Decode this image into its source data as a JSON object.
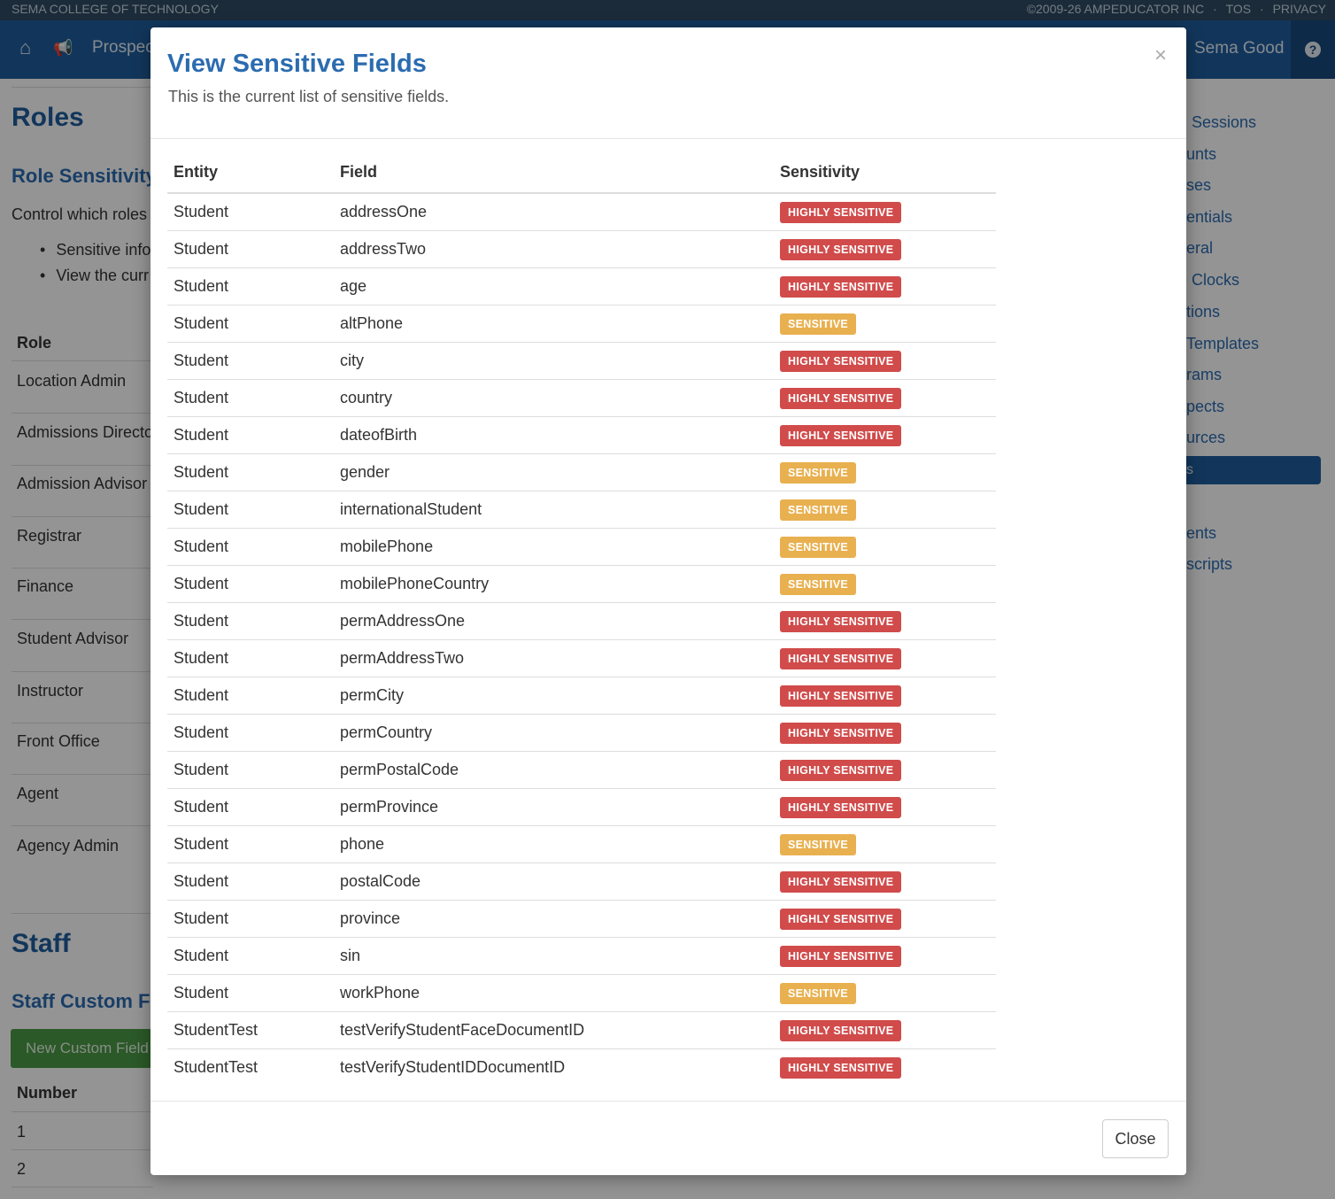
{
  "topstrip": {
    "school": "SEMA COLLEGE OF TECHNOLOGY",
    "copyright": "©2009-26 AMPEDUCATOR INC",
    "sep": "·",
    "tos": "TOS",
    "privacy": "PRIVACY"
  },
  "nav": {
    "home_glyph": "⌂",
    "announce_glyph": "📢",
    "prospects": "Prospec",
    "user": "Sema Good",
    "help_glyph": "?"
  },
  "background": {
    "roles_title": "Roles",
    "role_sensitivity": "Role Sensitivity",
    "control_text": "Control which roles",
    "bullets": [
      "Sensitive info",
      "View the curr"
    ],
    "role_header": "Role",
    "roles": [
      "Location Admin",
      "Admissions Directo",
      "Admission Advisor",
      "Registrar",
      "Finance",
      "Student Advisor",
      "Instructor",
      "Front Office",
      "Agent",
      "Agency Admin"
    ],
    "staff_title": "Staff",
    "staff_custom": "Staff Custom Fie",
    "new_custom_field": "New Custom Field",
    "number_header": "Number",
    "numbers": [
      "1",
      "2"
    ],
    "sidebar": [
      "Sessions",
      "unts",
      "ses",
      "entials",
      "eral",
      "Clocks",
      "tions",
      "Templates",
      "rams",
      "pects",
      "urces",
      "ents",
      "scripts"
    ],
    "sidebar_active": "s"
  },
  "modal": {
    "title": "View Sensitive Fields",
    "subtitle": "This is the current list of sensitive fields.",
    "close_x": "×",
    "close_button": "Close",
    "headers": {
      "entity": "Entity",
      "field": "Field",
      "sensitivity": "Sensitivity"
    },
    "rows": [
      {
        "entity": "Student",
        "field": "addressOne",
        "sensitivity": "HIGHLY SENSITIVE",
        "level": "high"
      },
      {
        "entity": "Student",
        "field": "addressTwo",
        "sensitivity": "HIGHLY SENSITIVE",
        "level": "high"
      },
      {
        "entity": "Student",
        "field": "age",
        "sensitivity": "HIGHLY SENSITIVE",
        "level": "high"
      },
      {
        "entity": "Student",
        "field": "altPhone",
        "sensitivity": "SENSITIVE",
        "level": "med"
      },
      {
        "entity": "Student",
        "field": "city",
        "sensitivity": "HIGHLY SENSITIVE",
        "level": "high"
      },
      {
        "entity": "Student",
        "field": "country",
        "sensitivity": "HIGHLY SENSITIVE",
        "level": "high"
      },
      {
        "entity": "Student",
        "field": "dateofBirth",
        "sensitivity": "HIGHLY SENSITIVE",
        "level": "high"
      },
      {
        "entity": "Student",
        "field": "gender",
        "sensitivity": "SENSITIVE",
        "level": "med"
      },
      {
        "entity": "Student",
        "field": "internationalStudent",
        "sensitivity": "SENSITIVE",
        "level": "med"
      },
      {
        "entity": "Student",
        "field": "mobilePhone",
        "sensitivity": "SENSITIVE",
        "level": "med"
      },
      {
        "entity": "Student",
        "field": "mobilePhoneCountry",
        "sensitivity": "SENSITIVE",
        "level": "med"
      },
      {
        "entity": "Student",
        "field": "permAddressOne",
        "sensitivity": "HIGHLY SENSITIVE",
        "level": "high"
      },
      {
        "entity": "Student",
        "field": "permAddressTwo",
        "sensitivity": "HIGHLY SENSITIVE",
        "level": "high"
      },
      {
        "entity": "Student",
        "field": "permCity",
        "sensitivity": "HIGHLY SENSITIVE",
        "level": "high"
      },
      {
        "entity": "Student",
        "field": "permCountry",
        "sensitivity": "HIGHLY SENSITIVE",
        "level": "high"
      },
      {
        "entity": "Student",
        "field": "permPostalCode",
        "sensitivity": "HIGHLY SENSITIVE",
        "level": "high"
      },
      {
        "entity": "Student",
        "field": "permProvince",
        "sensitivity": "HIGHLY SENSITIVE",
        "level": "high"
      },
      {
        "entity": "Student",
        "field": "phone",
        "sensitivity": "SENSITIVE",
        "level": "med"
      },
      {
        "entity": "Student",
        "field": "postalCode",
        "sensitivity": "HIGHLY SENSITIVE",
        "level": "high"
      },
      {
        "entity": "Student",
        "field": "province",
        "sensitivity": "HIGHLY SENSITIVE",
        "level": "high"
      },
      {
        "entity": "Student",
        "field": "sin",
        "sensitivity": "HIGHLY SENSITIVE",
        "level": "high"
      },
      {
        "entity": "Student",
        "field": "workPhone",
        "sensitivity": "SENSITIVE",
        "level": "med"
      },
      {
        "entity": "StudentTest",
        "field": "testVerifyStudentFaceDocumentID",
        "sensitivity": "HIGHLY SENSITIVE",
        "level": "high"
      },
      {
        "entity": "StudentTest",
        "field": "testVerifyStudentIDDocumentID",
        "sensitivity": "HIGHLY SENSITIVE",
        "level": "high"
      }
    ]
  },
  "colors": {
    "topstrip": "#2f4a63",
    "navbar": "#1f5d9e",
    "title_blue": "#2b6cb0",
    "highly_sensitive": "#d14b4b",
    "sensitive": "#e8b04f",
    "green_button": "#4a9a45"
  }
}
